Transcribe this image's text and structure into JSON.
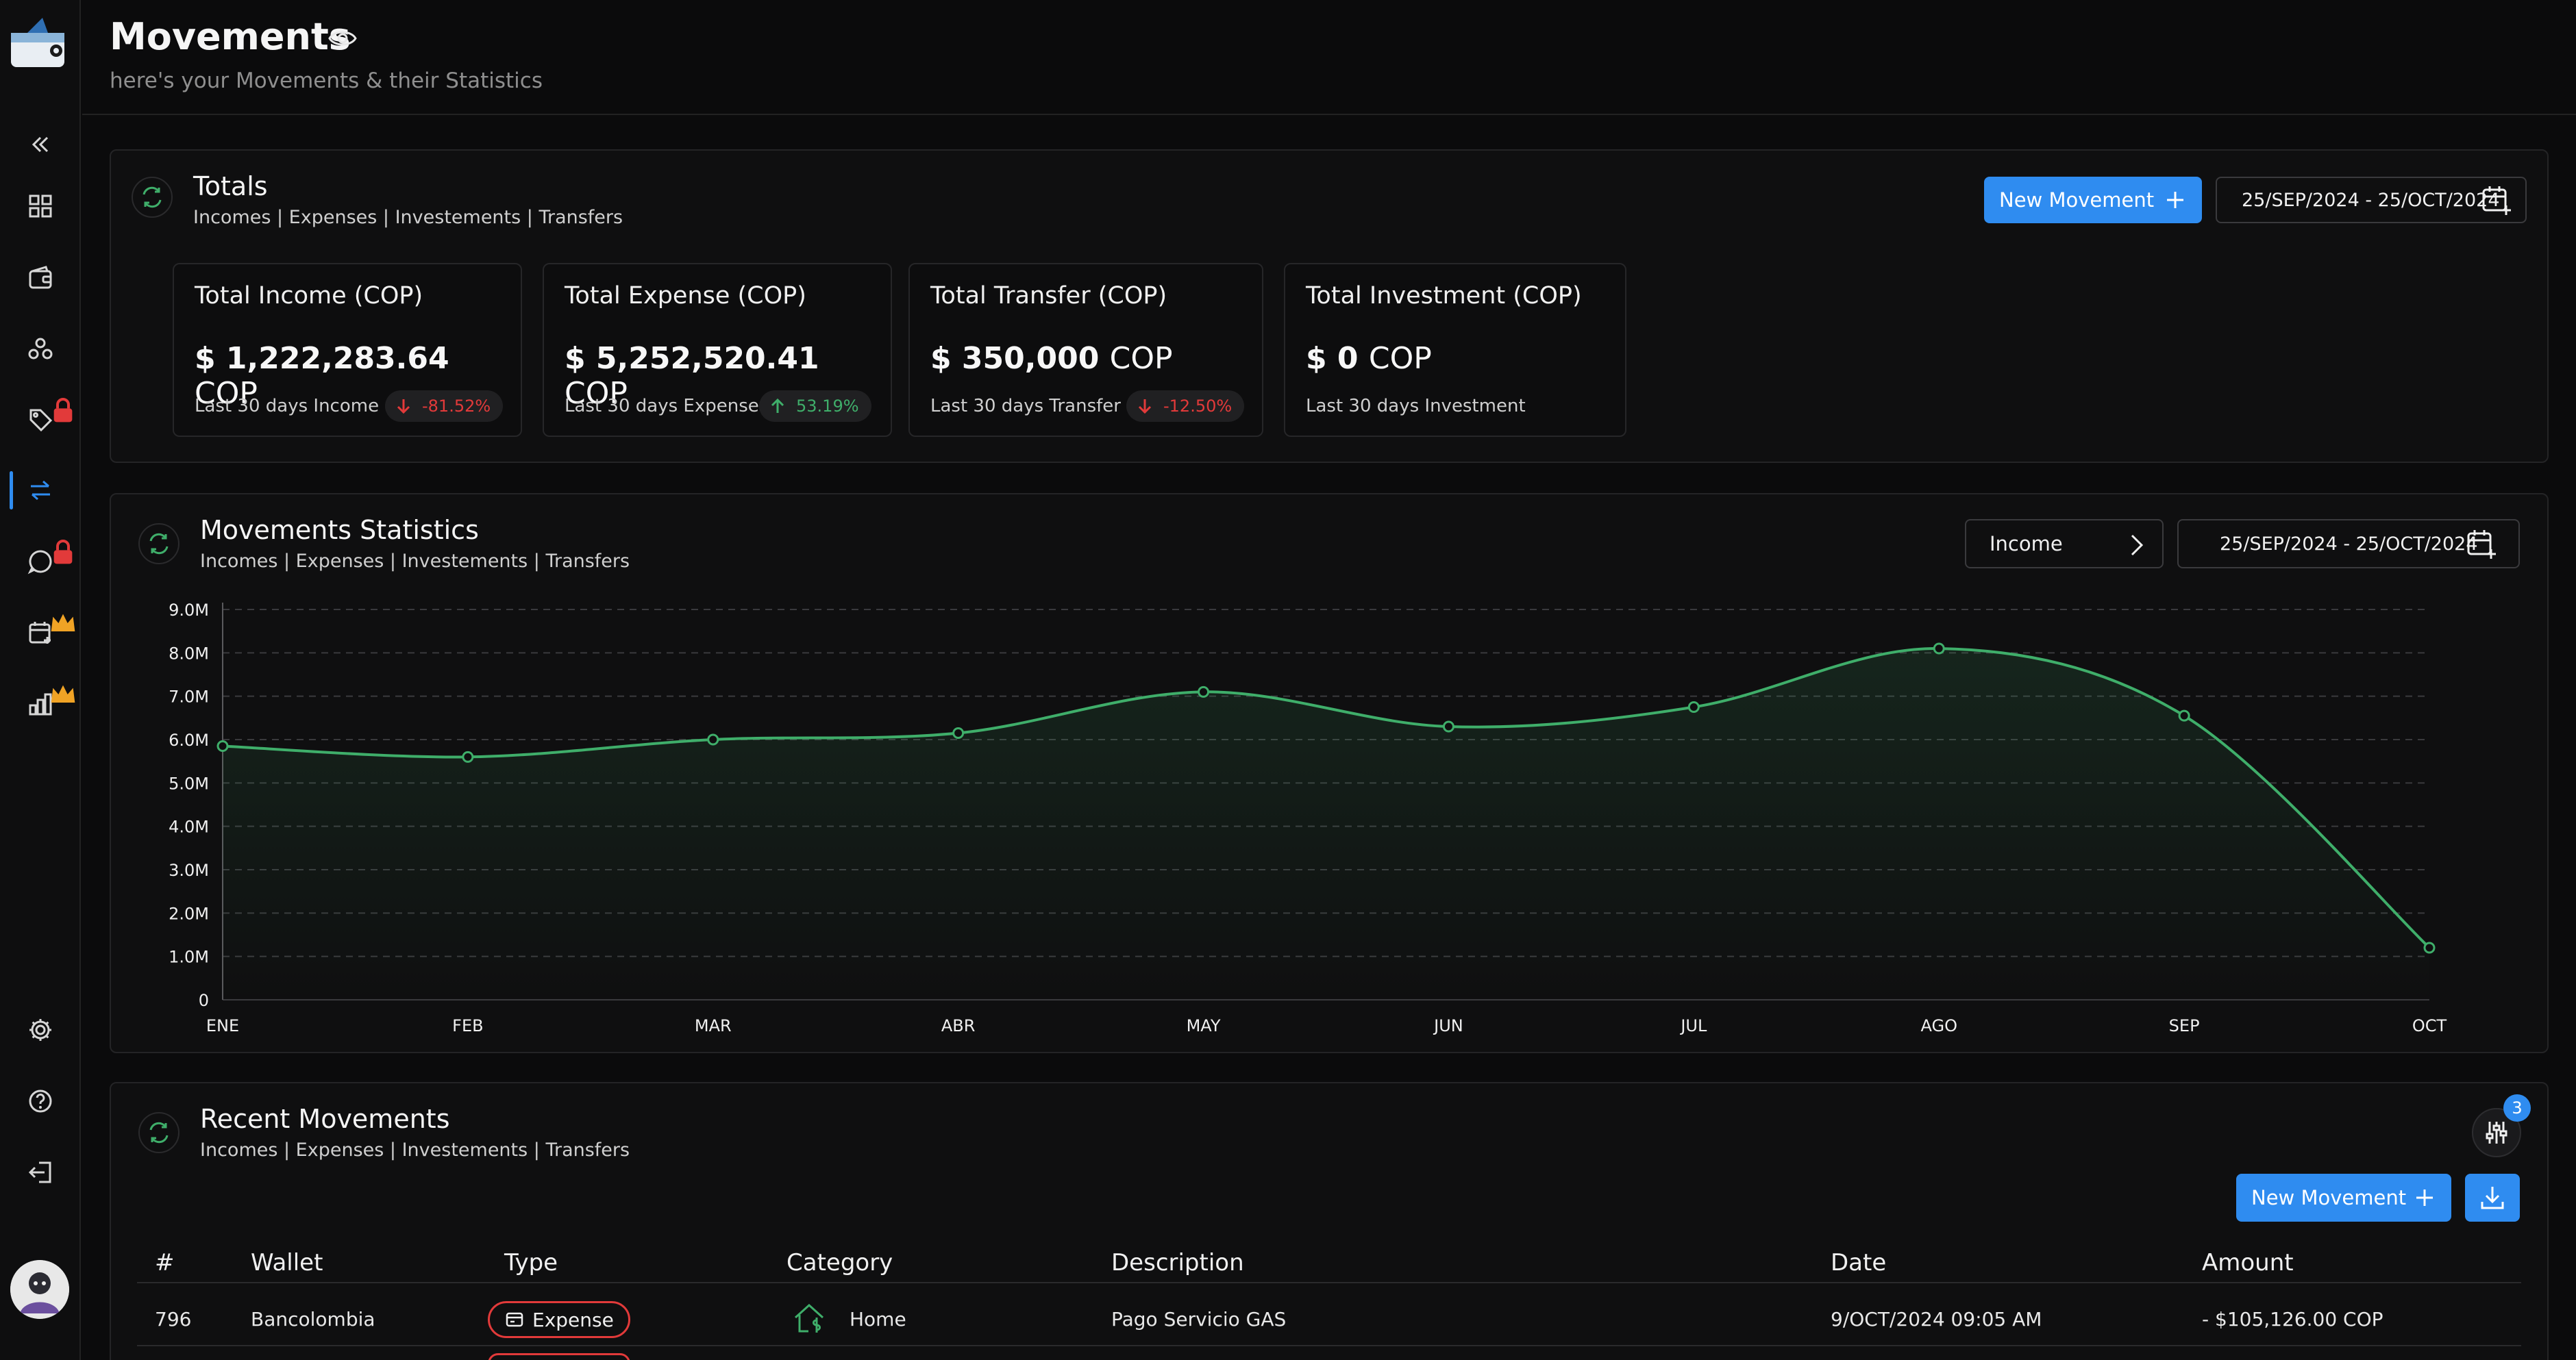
{
  "header": {
    "title": "Movements",
    "subtitle": "here's your Movements & their Statistics"
  },
  "sidebar": {
    "items": [
      {
        "name": "collapse",
        "icon": "double-chevron-left-icon"
      },
      {
        "name": "dashboard",
        "icon": "grid-icon"
      },
      {
        "name": "wallets",
        "icon": "wallet-icon"
      },
      {
        "name": "groups",
        "icon": "people-icon"
      },
      {
        "name": "tags",
        "icon": "tag-icon",
        "badge": "lock"
      },
      {
        "name": "movements",
        "icon": "arrows-swap-icon",
        "active": true
      },
      {
        "name": "whatsapp",
        "icon": "chat-icon",
        "badge": "lock"
      },
      {
        "name": "calendar",
        "icon": "calendar-add-icon",
        "badge": "crown"
      },
      {
        "name": "reports",
        "icon": "bar-chart-icon",
        "badge": "crown"
      },
      {
        "name": "settings",
        "icon": "gear-icon"
      },
      {
        "name": "help",
        "icon": "question-icon"
      },
      {
        "name": "logout",
        "icon": "logout-icon"
      }
    ]
  },
  "totals": {
    "title": "Totals",
    "subtitle": "Incomes | Expenses | Investements | Transfers",
    "new_movement_label": "New Movement",
    "date_range": "25/SEP/2024 - 25/OCT/2024",
    "cards": [
      {
        "label": "Total Income (COP)",
        "amount": "$ 1,222,283.64",
        "currency": "COP",
        "period": "Last 30 days Income",
        "change": "-81.52%",
        "direction": "down"
      },
      {
        "label": "Total Expense (COP)",
        "amount": "$ 5,252,520.41",
        "currency": "COP",
        "period": "Last 30 days Expense",
        "change": "53.19%",
        "direction": "up"
      },
      {
        "label": "Total Transfer (COP)",
        "amount": "$ 350,000",
        "currency": "COP",
        "period": "Last 30 days Transfer",
        "change": "-12.50%",
        "direction": "down"
      },
      {
        "label": "Total Investment (COP)",
        "amount": "$ 0",
        "currency": "COP",
        "period": "Last 30 days Investment",
        "change": null,
        "direction": null
      }
    ]
  },
  "statistics": {
    "title": "Movements Statistics",
    "subtitle": "Incomes | Expenses | Investements | Transfers",
    "selector_label": "Income",
    "date_range": "25/SEP/2024 - 25/OCT/2024"
  },
  "chart_data": {
    "type": "area",
    "categories": [
      "ENE",
      "FEB",
      "MAR",
      "ABR",
      "MAY",
      "JUN",
      "JUL",
      "AGO",
      "SEP",
      "OCT"
    ],
    "series": [
      {
        "values": [
          5.85,
          5.6,
          6.0,
          6.15,
          7.1,
          6.3,
          6.75,
          8.1,
          6.55,
          1.2
        ]
      }
    ],
    "ylim": [
      0,
      9
    ],
    "yticks": [
      {
        "v": 9,
        "label": "9.0M"
      },
      {
        "v": 8,
        "label": "8.0M"
      },
      {
        "v": 7,
        "label": "7.0M"
      },
      {
        "v": 6,
        "label": "6.0M"
      },
      {
        "v": 5,
        "label": "5.0M"
      },
      {
        "v": 4,
        "label": "4.0M"
      },
      {
        "v": 3,
        "label": "3.0M"
      },
      {
        "v": 2,
        "label": "2.0M"
      },
      {
        "v": 1,
        "label": "1.0M"
      },
      {
        "v": 0,
        "label": "0"
      }
    ],
    "grid": true,
    "line_color": "#3fae6a"
  },
  "recent": {
    "title": "Recent Movements",
    "subtitle": "Incomes | Expenses | Investements | Transfers",
    "filter_count": "3",
    "new_movement_label": "New Movement",
    "columns": [
      "#",
      "Wallet",
      "Type",
      "Category",
      "Description",
      "Date",
      "Amount"
    ],
    "rows": [
      {
        "id": "796",
        "wallet": "Bancolombia",
        "type": "Expense",
        "category": "Home",
        "description": "Pago Servicio GAS",
        "date": "9/OCT/2024 09:05 AM",
        "amount": "- $105,126.00 COP"
      }
    ]
  },
  "colors": {
    "accent": "#2f8cf0",
    "negative": "#e23a3a",
    "positive": "#3fae6a",
    "background": "#0b0b0c"
  }
}
